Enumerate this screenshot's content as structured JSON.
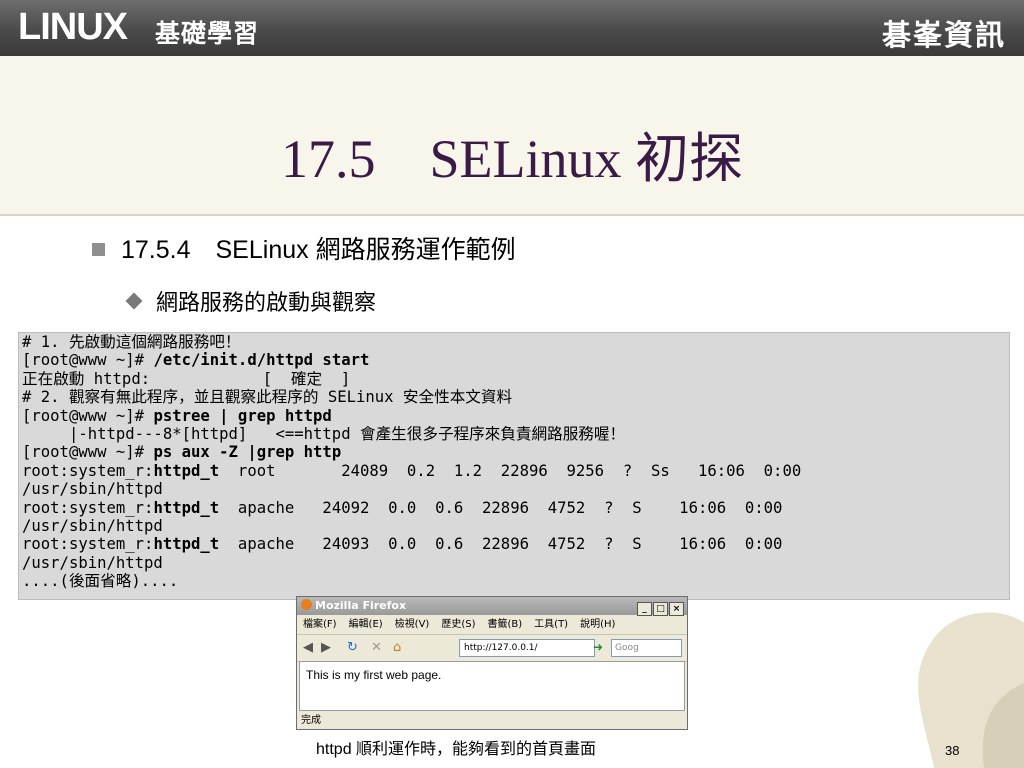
{
  "header": {
    "brand": "LINUX",
    "brand_sub": "基礎學習",
    "publisher": "碁峯資訊"
  },
  "title": "17.5　SELinux 初探",
  "bullets": {
    "level1": "17.5.4　SELinux 網路服務運作範例",
    "level2": "網路服務的啟動與觀察"
  },
  "code_lines": [
    [
      {
        "t": "# 1. 先啟動這個網路服務吧！",
        "b": false
      }
    ],
    [
      {
        "t": "[root@www ~]# ",
        "b": false
      },
      {
        "t": "/etc/init.d/httpd start",
        "b": true
      }
    ],
    [
      {
        "t": "正在啟動 httpd:            [  確定  ]",
        "b": false
      }
    ],
    [
      {
        "t": "# 2. 觀察有無此程序，並且觀察此程序的 SELinux 安全性本文資料",
        "b": false
      }
    ],
    [
      {
        "t": "[root@www ~]# ",
        "b": false
      },
      {
        "t": "pstree | grep httpd",
        "b": true
      }
    ],
    [
      {
        "t": "     |-httpd---8*[httpd]   <==httpd 會產生很多子程序來負責網路服務喔！",
        "b": false
      }
    ],
    [
      {
        "t": "[root@www ~]# ",
        "b": false
      },
      {
        "t": "ps aux -Z |grep http",
        "b": true
      }
    ],
    [
      {
        "t": "root:system_r:",
        "b": false
      },
      {
        "t": "httpd_t",
        "b": true
      },
      {
        "t": "  root       24089  0.2  1.2  22896  9256  ?  Ss   16:06  0:00",
        "b": false
      }
    ],
    [
      {
        "t": "/usr/sbin/httpd",
        "b": false
      }
    ],
    [
      {
        "t": "root:system_r:",
        "b": false
      },
      {
        "t": "httpd_t",
        "b": true
      },
      {
        "t": "  apache   24092  0.0  0.6  22896  4752  ?  S    16:06  0:00",
        "b": false
      }
    ],
    [
      {
        "t": "/usr/sbin/httpd",
        "b": false
      }
    ],
    [
      {
        "t": "root:system_r:",
        "b": false
      },
      {
        "t": "httpd_t",
        "b": true
      },
      {
        "t": "  apache   24093  0.0  0.6  22896  4752  ?  S    16:06  0:00",
        "b": false
      }
    ],
    [
      {
        "t": "/usr/sbin/httpd",
        "b": false
      }
    ],
    [
      {
        "t": "....(後面省略)....",
        "b": false
      }
    ]
  ],
  "browser": {
    "title": "Mozilla Firefox",
    "menu": [
      "檔案(F)",
      "編輯(E)",
      "檢視(V)",
      "歷史(S)",
      "書籤(B)",
      "工具(T)",
      "說明(H)"
    ],
    "url": "http://127.0.0.1/",
    "search_placeholder": "Goog",
    "content": "This is my first web page.",
    "status": "完成"
  },
  "caption": "httpd 順利運作時，能夠看到的首頁畫面",
  "page_number": "38",
  "colors": {
    "title": "#3a1b47",
    "header_bg": "#4a4a4a",
    "code_bg": "#d9d9d9"
  }
}
